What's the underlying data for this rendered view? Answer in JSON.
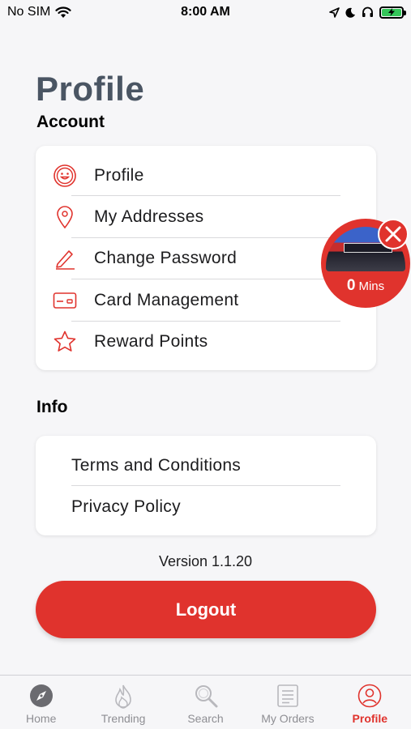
{
  "status_bar": {
    "carrier": "No SIM",
    "time": "8:00 AM"
  },
  "page_title": "Profile",
  "account": {
    "title": "Account",
    "items": [
      {
        "label": "Profile",
        "icon": "smiley-icon"
      },
      {
        "label": "My Addresses",
        "icon": "location-pin-icon"
      },
      {
        "label": "Change Password",
        "icon": "pencil-icon"
      },
      {
        "label": "Card Management",
        "icon": "credit-card-icon"
      },
      {
        "label": "Reward Points",
        "icon": "star-icon"
      }
    ]
  },
  "info": {
    "title": "Info",
    "items": [
      {
        "label": "Terms and Conditions"
      },
      {
        "label": "Privacy Policy"
      }
    ]
  },
  "version_text": "Version 1.1.20",
  "logout_label": "Logout",
  "floating_widget": {
    "minutes_value": "0",
    "minutes_unit": "Mins"
  },
  "tab_bar": {
    "tabs": [
      {
        "label": "Home",
        "icon": "compass-icon"
      },
      {
        "label": "Trending",
        "icon": "flame-icon"
      },
      {
        "label": "Search",
        "icon": "search-icon"
      },
      {
        "label": "My Orders",
        "icon": "receipt-icon"
      },
      {
        "label": "Profile",
        "icon": "user-icon"
      }
    ],
    "active_index": 4
  },
  "colors": {
    "accent": "#e0332d",
    "title_gray": "#4a5563",
    "background": "#f6f6f8",
    "tab_inactive": "#8e8e93"
  }
}
